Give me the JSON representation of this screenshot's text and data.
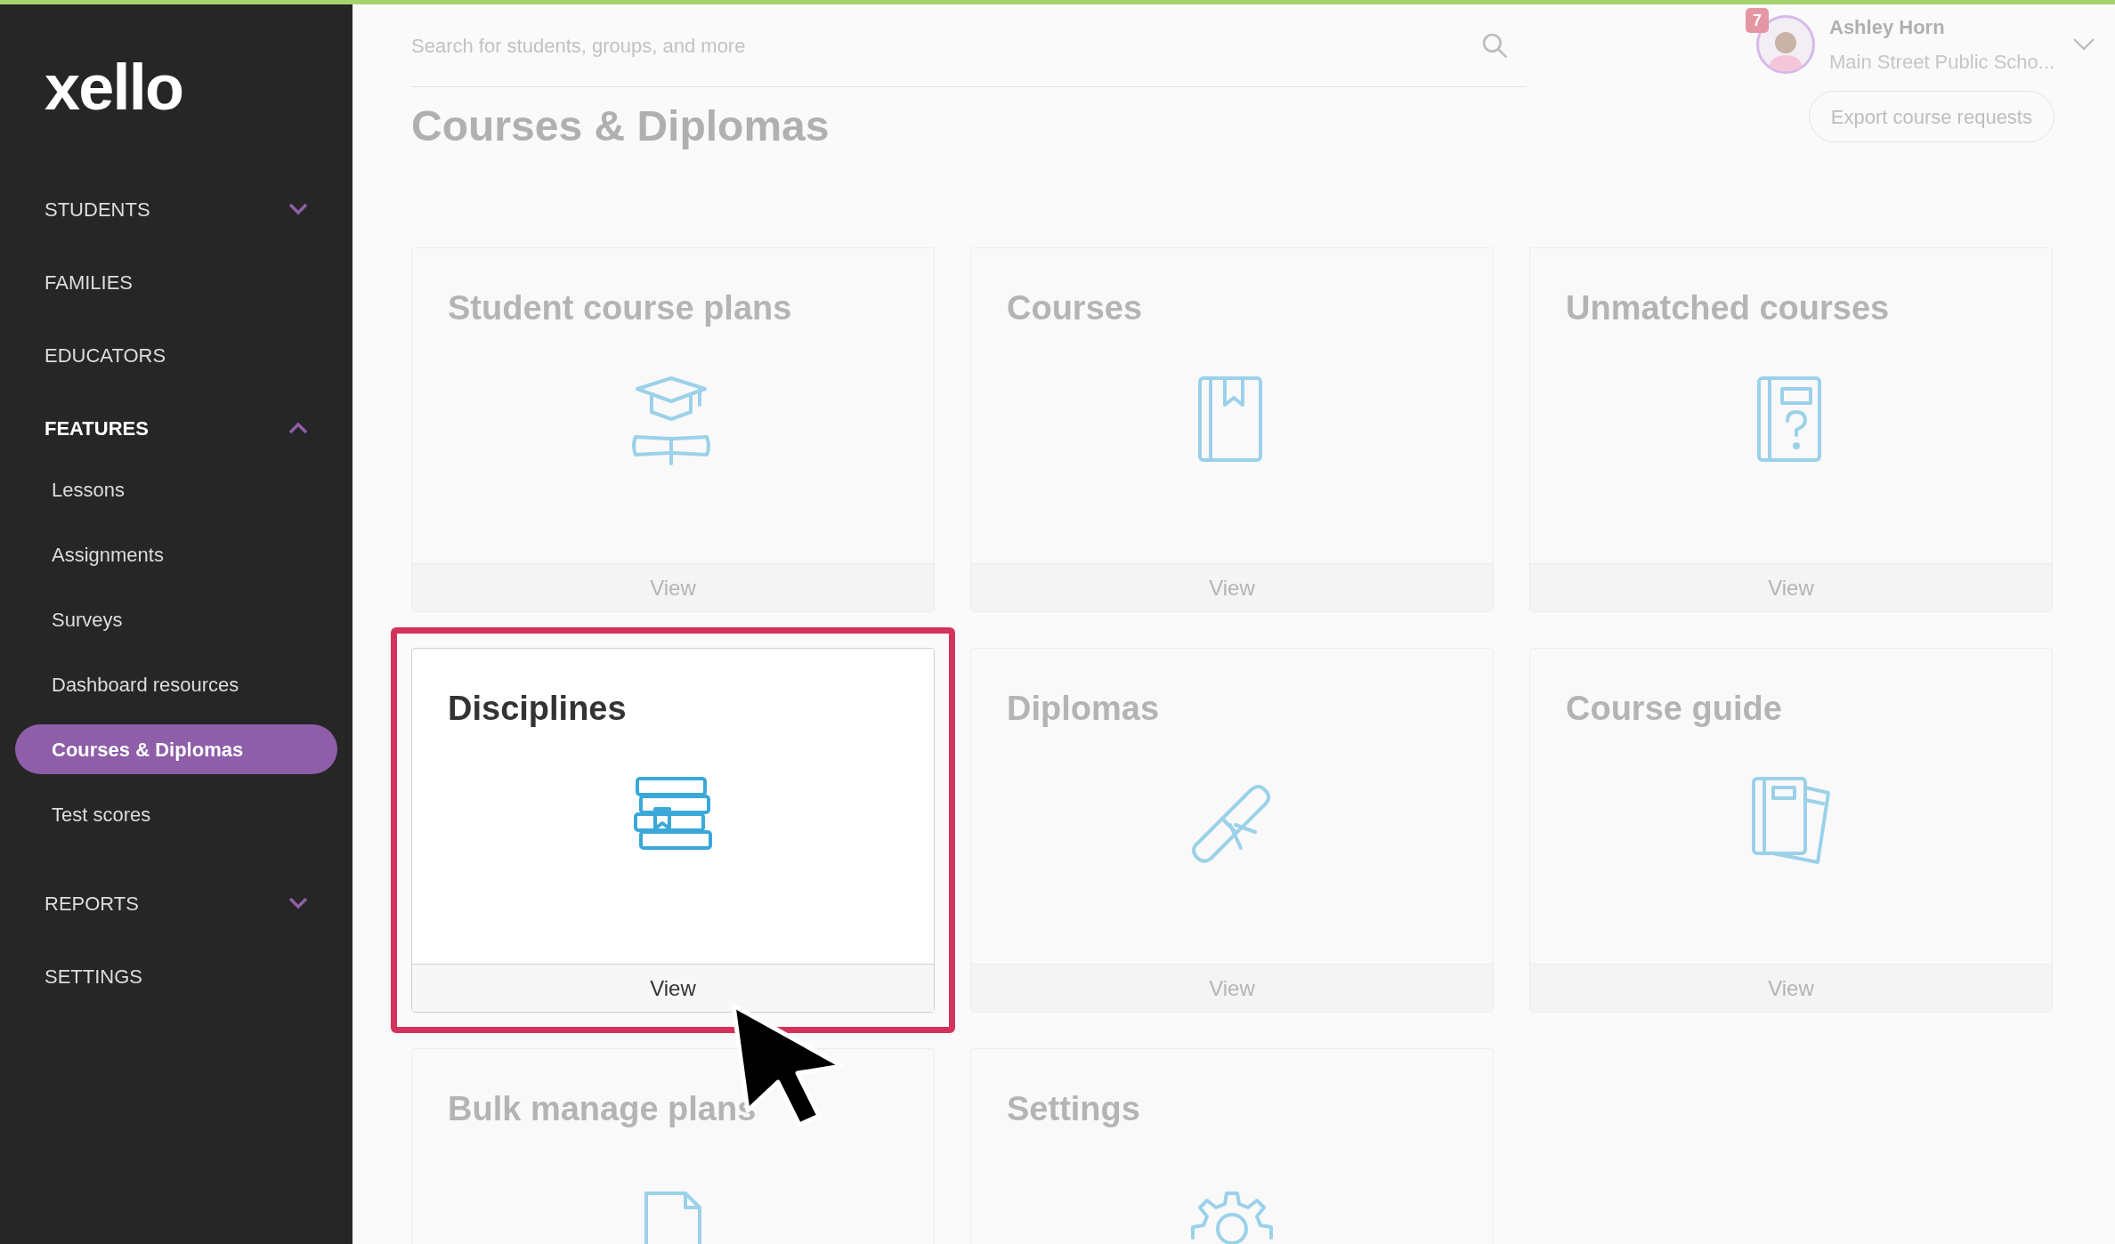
{
  "logo": "xello",
  "sidebar": {
    "items": [
      {
        "label": "STUDENTS",
        "active": false,
        "expanded": false
      },
      {
        "label": "FAMILIES",
        "active": false
      },
      {
        "label": "EDUCATORS",
        "active": false
      },
      {
        "label": "FEATURES",
        "active": true,
        "expanded": true,
        "children": [
          {
            "label": "Lessons",
            "selected": false
          },
          {
            "label": "Assignments",
            "selected": false
          },
          {
            "label": "Surveys",
            "selected": false
          },
          {
            "label": "Dashboard resources",
            "selected": false
          },
          {
            "label": "Courses & Diplomas",
            "selected": true
          },
          {
            "label": "Test scores",
            "selected": false
          }
        ]
      },
      {
        "label": "REPORTS",
        "active": false,
        "expanded": false
      },
      {
        "label": "SETTINGS",
        "active": false
      }
    ]
  },
  "search": {
    "placeholder": "Search for students, groups, and more"
  },
  "user": {
    "name": "Ashley Horn",
    "school": "Main Street Public Scho...",
    "notifications": "7"
  },
  "page_title": "Courses & Diplomas",
  "export_button": "Export course requests",
  "cards": [
    {
      "title": "Student course plans",
      "action": "View",
      "highlighted": false
    },
    {
      "title": "Courses",
      "action": "View",
      "highlighted": false
    },
    {
      "title": "Unmatched courses",
      "action": "View",
      "highlighted": false
    },
    {
      "title": "Disciplines",
      "action": "View",
      "highlighted": true
    },
    {
      "title": "Diplomas",
      "action": "View",
      "highlighted": false
    },
    {
      "title": "Course guide",
      "action": "View",
      "highlighted": false
    },
    {
      "title": "Bulk manage plans",
      "highlighted": false
    },
    {
      "title": "Settings",
      "highlighted": false
    }
  ]
}
